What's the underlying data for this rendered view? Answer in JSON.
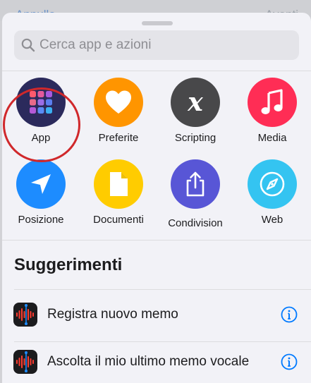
{
  "behind": {
    "left": "Annulla",
    "right": "Avanti"
  },
  "search": {
    "placeholder": "Cerca app e azioni"
  },
  "categories": [
    {
      "label": "App",
      "color": "#2b2a5c"
    },
    {
      "label": "Preferite",
      "color": "#ff9500"
    },
    {
      "label": "Scripting",
      "color": "#48484a"
    },
    {
      "label": "Media",
      "color": "#ff2d55"
    },
    {
      "label": "Posizione",
      "color": "#1d8cff"
    },
    {
      "label": "Documenti",
      "color": "#ffcc00"
    },
    {
      "label": "Condivision",
      "color": "#5856d6"
    },
    {
      "label": "Web",
      "color": "#34c4f1"
    }
  ],
  "suggestions": {
    "title": "Suggerimenti",
    "items": [
      {
        "label": "Registra nuovo memo",
        "icon": "voice-memos-icon"
      },
      {
        "label": "Ascolta il mio ultimo memo vocale",
        "icon": "voice-memos-icon"
      }
    ]
  },
  "accent": "#007aff",
  "highlight": "#d0282b"
}
